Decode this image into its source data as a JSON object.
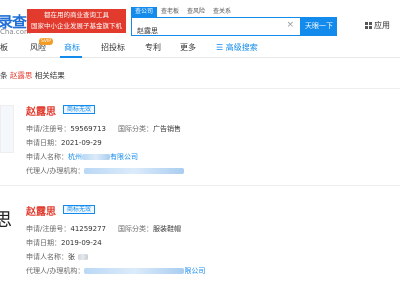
{
  "header": {
    "logo_text": "录查",
    "logo_sub": "Cha.com",
    "slogan_line1": "都在用的商业查询工具",
    "slogan_line2": "国家中小企业发展子基金旗下机构",
    "search_tabs": [
      "查公司",
      "查老板",
      "查风险",
      "查关系"
    ],
    "search_value": "赵露思",
    "search_clear": "×",
    "search_button": "天眼一下",
    "apps_label": "应用"
  },
  "nav": {
    "items": [
      "板",
      "风险",
      "商标",
      "招投标",
      "专利",
      "更多"
    ],
    "vip_badge": "SVIP",
    "advanced": "高级搜索"
  },
  "results": {
    "prefix": "条",
    "keyword": "赵露思",
    "suffix": "相关结果"
  },
  "cards": [
    {
      "name": "赵露思",
      "status": "商标无效",
      "reg_label": "申请/注册号：",
      "reg_no": "59569713",
      "class_label": "国际分类：",
      "class_value": "广告销售",
      "date_label": "申请日期：",
      "date": "2021-09-29",
      "applicant_label": "申请人名称：",
      "applicant_prefix": "杭州",
      "applicant_suffix": "有限公司",
      "agent_label": "代理人/办理机构："
    },
    {
      "name": "赵露思",
      "status": "商标无效",
      "thumb_glyph": "思",
      "reg_label": "申请/注册号：",
      "reg_no": "41259277",
      "class_label": "国际分类：",
      "class_value": "服装鞋帽",
      "date_label": "申请日期：",
      "date": "2019-09-24",
      "applicant_label": "申请人名称：",
      "applicant_prefix": "张",
      "agent_label": "代理人/办理机构：",
      "agent_suffix": "限公司"
    }
  ]
}
